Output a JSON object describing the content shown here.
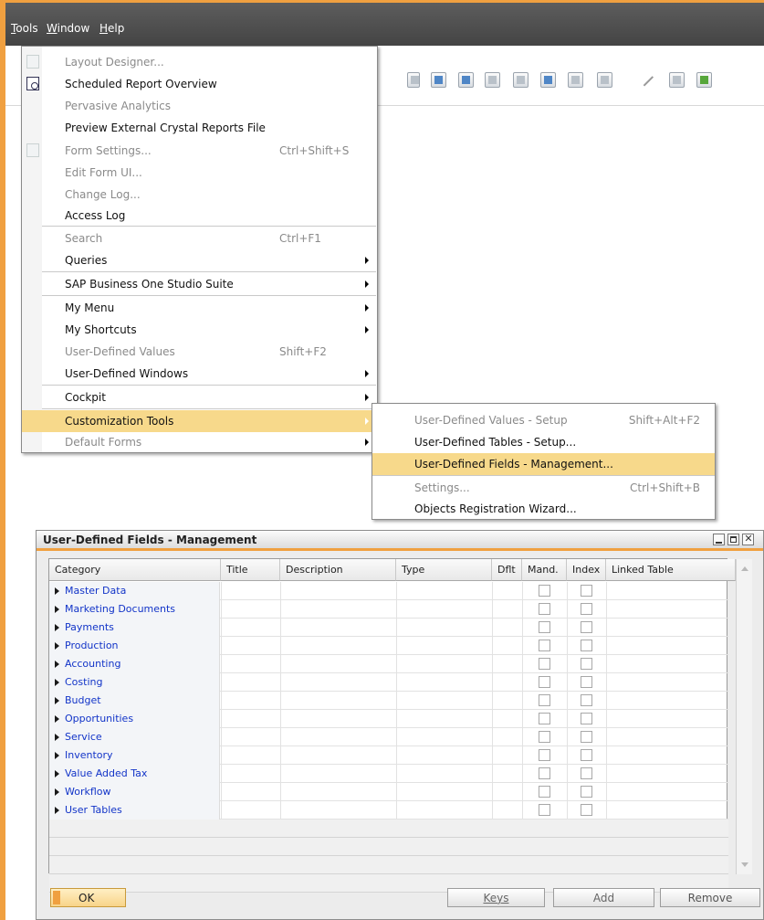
{
  "menubar": {
    "items": [
      {
        "label": "Tools",
        "mnemonic": "T",
        "rest": "ools"
      },
      {
        "label": "Window",
        "mnemonic": "W",
        "rest": "indow"
      },
      {
        "label": "Help",
        "mnemonic": "H",
        "rest": "elp"
      }
    ]
  },
  "tools_menu": {
    "items": [
      {
        "label": "Layout Designer...",
        "shortcut": "",
        "enabled": false,
        "submenu": false
      },
      {
        "label": "Scheduled Report Overview",
        "shortcut": "",
        "enabled": true,
        "submenu": false
      },
      {
        "label": "Pervasive Analytics",
        "shortcut": "",
        "enabled": false,
        "submenu": false
      },
      {
        "label": "Preview External Crystal Reports File",
        "shortcut": "",
        "enabled": true,
        "submenu": false
      },
      {
        "label": "Form Settings...",
        "shortcut": "Ctrl+Shift+S",
        "enabled": false,
        "submenu": false
      },
      {
        "label": "Edit Form UI...",
        "shortcut": "",
        "enabled": false,
        "submenu": false
      },
      {
        "label": "Change Log...",
        "shortcut": "",
        "enabled": false,
        "submenu": false
      },
      {
        "label": "Access Log",
        "shortcut": "",
        "enabled": true,
        "submenu": false
      },
      {
        "label": "Search",
        "shortcut": "Ctrl+F1",
        "enabled": false,
        "submenu": false
      },
      {
        "label": "Queries",
        "shortcut": "",
        "enabled": true,
        "submenu": true
      },
      {
        "label": "SAP Business One Studio Suite",
        "shortcut": "",
        "enabled": true,
        "submenu": true
      },
      {
        "label": "My Menu",
        "shortcut": "",
        "enabled": true,
        "submenu": true
      },
      {
        "label": "My Shortcuts",
        "shortcut": "",
        "enabled": true,
        "submenu": true
      },
      {
        "label": "User-Defined Values",
        "shortcut": "Shift+F2",
        "enabled": false,
        "submenu": false
      },
      {
        "label": "User-Defined Windows",
        "shortcut": "",
        "enabled": true,
        "submenu": true
      },
      {
        "label": "Cockpit",
        "shortcut": "",
        "enabled": true,
        "submenu": true
      },
      {
        "label": "Customization Tools",
        "shortcut": "",
        "enabled": true,
        "submenu": true,
        "highlighted": true
      },
      {
        "label": "Default Forms",
        "shortcut": "",
        "enabled": false,
        "submenu": true
      }
    ]
  },
  "customization_submenu": {
    "items": [
      {
        "label": "User-Defined Values - Setup",
        "shortcut": "Shift+Alt+F2",
        "enabled": false
      },
      {
        "label": "User-Defined Tables - Setup...",
        "shortcut": "",
        "enabled": true
      },
      {
        "label": "User-Defined Fields - Management...",
        "shortcut": "",
        "enabled": true,
        "highlighted": true
      },
      {
        "label": "Settings...",
        "shortcut": "Ctrl+Shift+B",
        "enabled": false
      },
      {
        "label": "Objects Registration Wizard...",
        "shortcut": "",
        "enabled": true
      }
    ]
  },
  "udf_window": {
    "title": "User-Defined Fields - Management",
    "columns": [
      "Category",
      "Title",
      "Description",
      "Type",
      "Dflt",
      "Mand.",
      "Index",
      "Linked Table"
    ],
    "rows": [
      "Master Data",
      "Marketing Documents",
      "Payments",
      "Production",
      "Accounting",
      "Costing",
      "Budget",
      "Opportunities",
      "Service",
      "Inventory",
      "Value Added Tax",
      "Workflow",
      "User Tables"
    ],
    "buttons": {
      "ok": "OK",
      "keys": "Keys",
      "add": "Add",
      "remove": "Remove"
    }
  },
  "colors": {
    "accent": "#f0a040",
    "highlight": "#f7d98b",
    "link_blue": "#1234c8",
    "menubar_bg": "#4d4d4d"
  }
}
